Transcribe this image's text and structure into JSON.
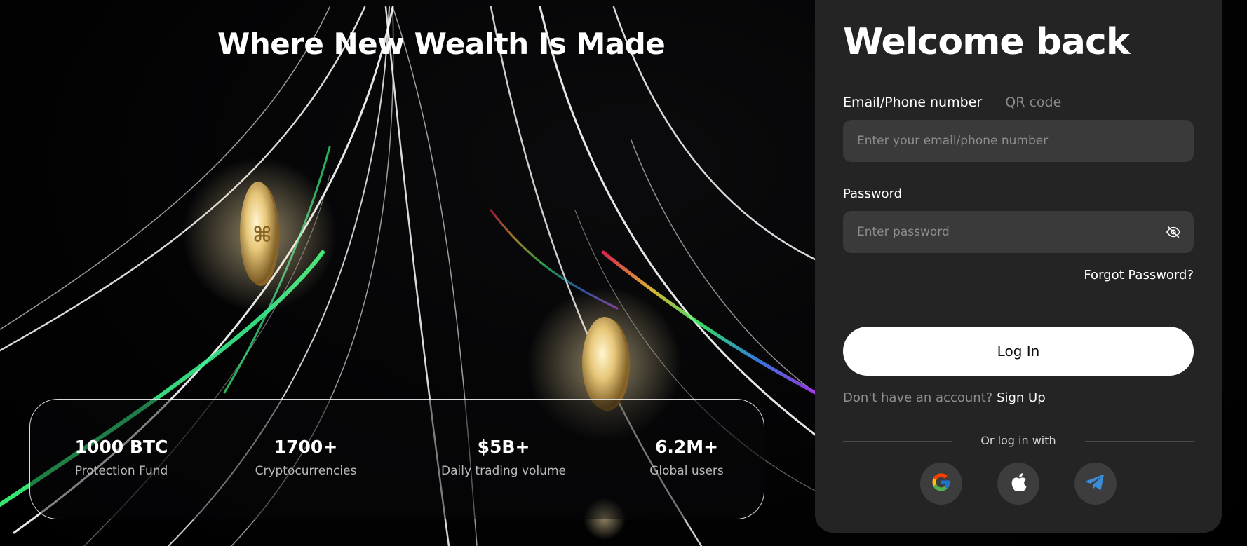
{
  "hero": {
    "title": "Where New Wealth Is Made"
  },
  "stats": [
    {
      "value": "1000 BTC",
      "label": "Protection Fund"
    },
    {
      "value": "1700+",
      "label": "Cryptocurrencies"
    },
    {
      "value": "$5B+",
      "label": "Daily trading volume"
    },
    {
      "value": "6.2M+",
      "label": "Global users"
    }
  ],
  "login": {
    "title": "Welcome back",
    "tabs": [
      {
        "label": "Email/Phone number",
        "active": true
      },
      {
        "label": "QR code",
        "active": false
      }
    ],
    "email": {
      "value": "",
      "placeholder": "Enter your email/phone number"
    },
    "password": {
      "label": "Password",
      "value": "",
      "placeholder": "Enter password"
    },
    "forgot_label": "Forgot Password?",
    "login_label": "Log In",
    "signup_prompt": "Don't have an account?",
    "signup_label": "Sign Up",
    "divider_text": "Or log in with",
    "social_icons": [
      "google-icon",
      "apple-icon",
      "telegram-icon"
    ]
  },
  "colors": {
    "panel_bg": "#242424",
    "field_bg": "#3a3a3a",
    "button_bg": "#ffffff",
    "telegram_blue": "#3a8ed8"
  }
}
